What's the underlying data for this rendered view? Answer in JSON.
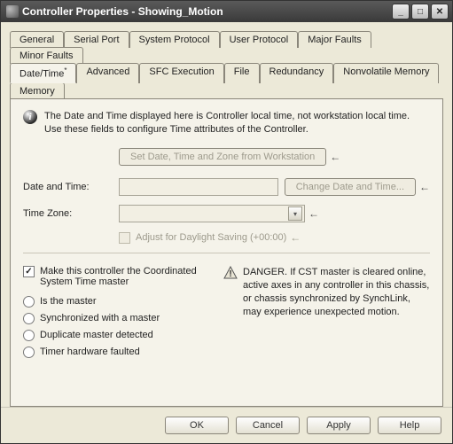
{
  "window": {
    "title": "Controller Properties - Showing_Motion"
  },
  "tabs_row1": [
    "General",
    "Serial Port",
    "System Protocol",
    "User Protocol",
    "Major Faults",
    "Minor Faults"
  ],
  "tabs_row2": [
    "Date/Time",
    "Advanced",
    "SFC Execution",
    "File",
    "Redundancy",
    "Nonvolatile Memory",
    "Memory"
  ],
  "active_tab_marker": "*",
  "info": {
    "line1": "The Date and Time displayed here is Controller local time, not workstation local time.",
    "line2": "Use these fields to configure Time attributes of the Controller."
  },
  "buttons": {
    "set_from_ws": "Set Date, Time and Zone from Workstation",
    "change_dt": "Change Date and Time...",
    "ok": "OK",
    "cancel": "Cancel",
    "apply": "Apply",
    "help": "Help"
  },
  "labels": {
    "date_and_time": "Date and Time:",
    "time_zone": "Time Zone:"
  },
  "checkboxes": {
    "adjust_dst": "Adjust for Daylight Saving (+00:00)",
    "make_cst_master": "Make this controller the Coordinated System Time master"
  },
  "radios": {
    "is_master": "Is the master",
    "synced": "Synchronized with a master",
    "dup_master": "Duplicate master detected",
    "hw_fault": "Timer hardware faulted"
  },
  "warning": {
    "title": "DANGER.",
    "body": "If CST master is cleared online, active axes in any controller in this chassis, or chassis synchronized by SynchLink, may experience unexpected motion."
  },
  "fields": {
    "date_time_value": "",
    "time_zone_value": ""
  }
}
